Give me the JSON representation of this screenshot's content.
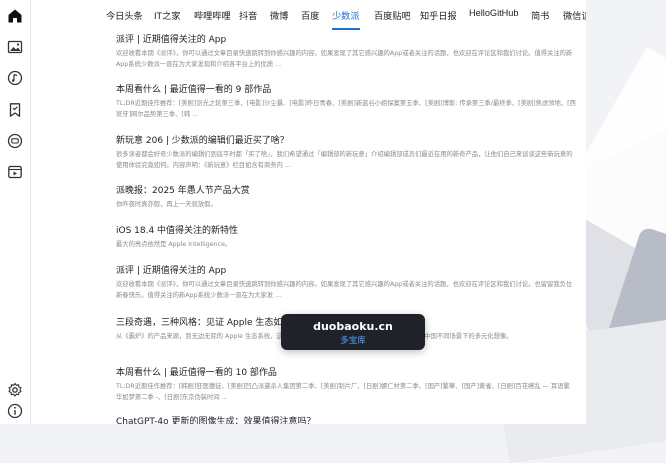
{
  "colors": {
    "accent": "#1b72d8",
    "toast_bg": "#1f2329",
    "toast_link": "#4ea1ff"
  },
  "sidebar": {
    "top_icons": [
      "home-icon",
      "image-icon",
      "music-icon",
      "bookmark-icon",
      "chat-icon",
      "video-icon"
    ],
    "bottom_icons": [
      "settings-icon",
      "info-icon"
    ]
  },
  "tabs": [
    {
      "label": "今日头条"
    },
    {
      "label": "IT之家"
    },
    {
      "label": "哔哩哔哩"
    },
    {
      "label": "抖音"
    },
    {
      "label": "微博"
    },
    {
      "label": "百度"
    },
    {
      "label": "少数派"
    },
    {
      "label": "百度贴吧"
    },
    {
      "label": "知乎日报"
    },
    {
      "label": "HelloGitHub"
    },
    {
      "label": "简书"
    },
    {
      "label": "微信读"
    }
  ],
  "active_tab": "少数派",
  "feed": [
    {
      "title": "派评 | 近期值得关注的 App",
      "desc": "欢迎收看本期《派评》，你可以通过文章目录快速跳转到你感兴趣的内容。如果发现了其它感兴趣的App或者关注的话题，也欢迎在评论区和我们讨论。值得关注的新App系统少数派一直在为大家发现和介绍各平台上的优质 ..."
    },
    {
      "title": "本周看什么 | 最近值得一看的 9 部作品",
      "desc": "TL;DR近期佳作推荐：[美剧]剑光之轮第三季、[电影]沙尘暴、[电影]昨日青春、[美剧]新蓝谷小姐探案第五季、[美剧]博斯: 传承第三季/最终季、[美剧]焦虑领地、[西班牙]网尔品势第三季、[韩 ..."
    },
    {
      "title": "新玩意 206 | 少数派的编辑们最近买了啥？",
      "desc": "很多读者都会好奇少数派的编辑们到底平时都「买了啥」，我们希望通过「编辑部的新玩意」介绍编辑部成员们最近在用的新奇产品，让他们自己来谈谈这些新玩意的使用体验究竟如何。内容声明：《新玩意》栏目如含有商务内 ..."
    },
    {
      "title": "派晚报：2025 年愚人节产品大赏",
      "desc": "你昨夜时真亦假，再上一天就放假。"
    },
    {
      "title": "iOS 18.4 中值得关注的新特性",
      "desc": "最大的亮点依然是 Apple Intelligence。"
    },
    {
      "title": "派评 | 近期值得关注的 App",
      "desc": "欢迎收看本期《派评》，你可以通过文章目录快速跳转到你感兴趣的内容。如果发现了其它感兴趣的App或者关注的话题，也欢迎在评论区和我们讨论。也留留我负位新春快乐。值得关注的新App系统少数派一直在为大家发 ..."
    },
    {
      "title": "三段奇遇，三种风格：见证 Apple 生态如何 ...",
      "desc": "从《霸炉》的产品来源，到无边无际的 Apple 生态系统，这些都在关注着并讨论的生动新鲜，了 Apple 生态在中国不同场景下的多元化想像。"
    },
    {
      "title": "本周看什么 | 最近值得一看的 10 部作品",
      "desc": "TL;DR近期佳作推荐：[韩剧]狂医魔徒、[美剧]凹凸派遣杀人集团第二季、[美剧]制片厂、[日剧]螺仁村第二季、[国产]繁華、[国产]黄雀、[日剧]百花缭乱 — 耳语繁华如梦第二季 -、[日剧]东京伪装时间 ..."
    },
    {
      "title": "ChatGPT-4o 更新的图像生成：效果值得注意吗？",
      "desc": ""
    }
  ],
  "toast": {
    "domain": "duobaoku.cn",
    "name": "多宝库"
  }
}
